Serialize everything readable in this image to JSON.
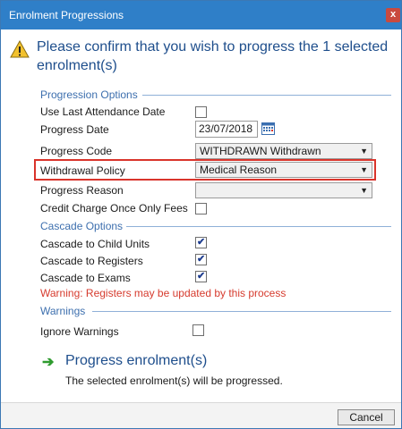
{
  "window": {
    "title": "Enrolment Progressions",
    "close_label": "x"
  },
  "headline": "Please confirm that you wish to progress the 1 selected enrolment(s)",
  "progression_options": {
    "section_title": "Progression Options",
    "use_last_attendance_date": {
      "label": "Use Last Attendance Date",
      "checked": false
    },
    "progress_date": {
      "label": "Progress Date",
      "value": "23/07/2018"
    },
    "progress_code": {
      "label": "Progress Code",
      "value": "WITHDRAWN Withdrawn"
    },
    "withdrawal_policy": {
      "label": "Withdrawal Policy",
      "value": "Medical Reason"
    },
    "progress_reason": {
      "label": "Progress Reason",
      "value": ""
    },
    "credit_charge": {
      "label": "Credit Charge Once Only Fees",
      "checked": false
    }
  },
  "cascade_options": {
    "section_title": "Cascade Options",
    "child_units": {
      "label": "Cascade to Child Units",
      "checked": true
    },
    "registers": {
      "label": "Cascade to Registers",
      "checked": true
    },
    "exams": {
      "label": "Cascade to Exams",
      "checked": true
    },
    "warning_text": "Warning: Registers may be updated by this process"
  },
  "warnings": {
    "section_title": "Warnings",
    "ignore_warnings": {
      "label": "Ignore Warnings",
      "checked": false
    }
  },
  "action": {
    "label": "Progress enrolment(s)",
    "description": "The selected enrolment(s) will be progressed."
  },
  "footer": {
    "cancel_label": "Cancel"
  },
  "colors": {
    "titlebar": "#2f7fc8",
    "section": "#3d6fae",
    "warning": "#d63b2e",
    "highlight": "#d9342b",
    "arrow": "#2e9b2e"
  },
  "icons": {
    "headline": "warning-triangle-icon",
    "date": "calendar-icon",
    "action": "green-arrow-icon"
  }
}
